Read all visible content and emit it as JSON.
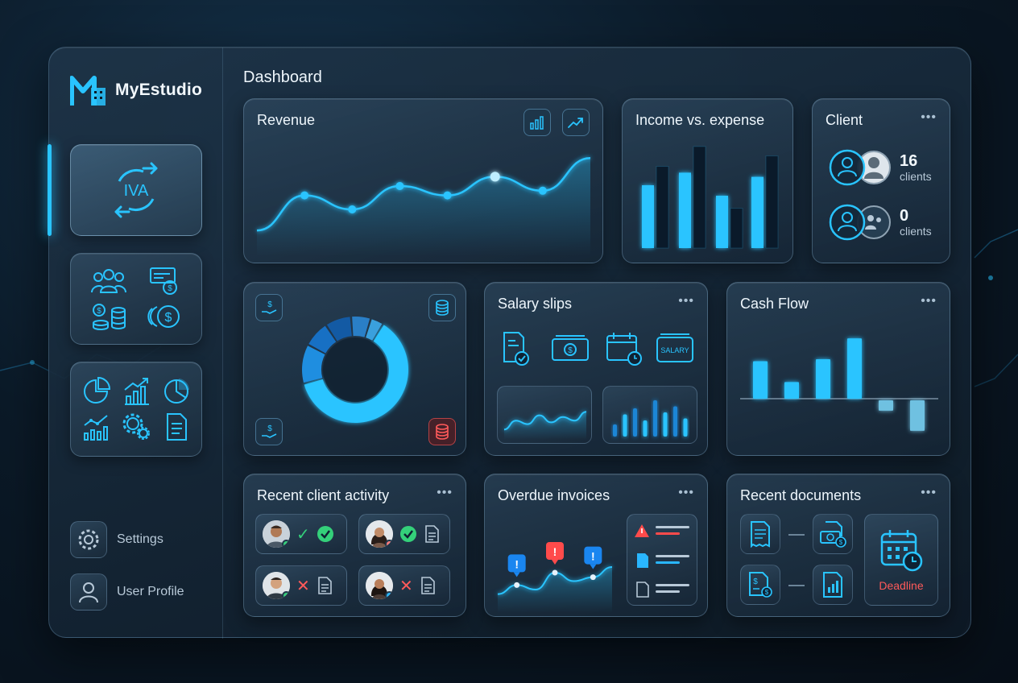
{
  "brand": {
    "name": "MyEstudio"
  },
  "page": {
    "title": "Dashboard"
  },
  "sidebar": {
    "cards": [
      {
        "icons": [
          "iva-exchange-icon"
        ],
        "label": "IVA",
        "active": true
      },
      {
        "icons": [
          "team-icon",
          "salary-slip-icon",
          "coin-transfer-icon",
          "coins-icon"
        ]
      },
      {
        "icons": [
          "pie-chart-icon",
          "bar-growth-icon",
          "pie-chart-icon",
          "line-bar-icon",
          "gears-icon",
          "document-icon"
        ]
      }
    ],
    "links": [
      {
        "label": "Settings",
        "icon": "gear-icon"
      },
      {
        "label": "User Profile",
        "icon": "user-icon"
      }
    ]
  },
  "revenue": {
    "title": "Revenue",
    "toolbar": [
      "bar-chart-icon",
      "trend-up-icon"
    ]
  },
  "income_expense": {
    "title": "Income vs. expense"
  },
  "client": {
    "title": "Client",
    "menu": "•••",
    "rows": [
      {
        "count": "16",
        "label": "clients"
      },
      {
        "count": "0",
        "label": "clients"
      }
    ]
  },
  "donut": {
    "corner_icons": [
      "hand-dollar-icon",
      "coin-stack-icon",
      "hand-dollar-icon",
      "coin-stack-alert-icon"
    ]
  },
  "salary": {
    "title": "Salary slips",
    "menu": "•••",
    "icons": [
      "checked-document-icon",
      "cash-icon",
      "calendar-clock-icon",
      "salary-card-icon"
    ],
    "salary_card_label": "SALARY"
  },
  "cashflow": {
    "title": "Cash Flow",
    "menu": "•••"
  },
  "activity": {
    "title": "Recent client activity",
    "menu": "•••",
    "items": [
      {
        "status": "approved",
        "status_dot": "#34d07a"
      },
      {
        "status": "approved",
        "status_dot": "#ff7a7a"
      },
      {
        "status": "rejected",
        "status_dot": "#34d07a"
      },
      {
        "status": "rejected",
        "status_dot": "#29b6ff"
      }
    ]
  },
  "overdue": {
    "title": "Overdue invoices",
    "menu": "•••",
    "alert_glyph": "!"
  },
  "documents": {
    "title": "Recent documents",
    "menu": "•••",
    "deadline_label": "Deadline"
  },
  "colors": {
    "accent": "#29c4ff",
    "accent_dark": "#0a1a2a",
    "alert": "#ff4b4b",
    "success": "#34d07a"
  },
  "chart_data": [
    {
      "type": "line",
      "title": "Revenue",
      "x": [
        1,
        2,
        3,
        4,
        5,
        6,
        7,
        8
      ],
      "values": [
        22,
        52,
        40,
        60,
        52,
        68,
        56,
        84
      ],
      "ylim": [
        0,
        100
      ],
      "grid": false
    },
    {
      "type": "bar",
      "title": "Income vs. expense",
      "categories": [
        "1",
        "2",
        "3",
        "4"
      ],
      "series": [
        {
          "values": [
            60,
            72,
            50,
            68
          ]
        },
        {
          "values": [
            78,
            97,
            38,
            88
          ]
        }
      ],
      "ylim": [
        0,
        100
      ]
    },
    {
      "type": "pie",
      "values": [
        62,
        12,
        8,
        8,
        6,
        4
      ]
    },
    {
      "type": "bar",
      "title": "Cash Flow",
      "categories": [
        "1",
        "2",
        "3",
        "4",
        "5",
        "6"
      ],
      "values": [
        54,
        24,
        57,
        87,
        -15,
        -44
      ],
      "ylim": [
        -50,
        100
      ]
    },
    {
      "type": "line",
      "x": [
        1,
        2,
        3,
        4,
        5,
        6,
        7,
        8
      ],
      "values": [
        20,
        45,
        35,
        60,
        40,
        55,
        45,
        70
      ],
      "ylim": [
        0,
        100
      ]
    },
    {
      "type": "bar",
      "values": [
        30,
        55,
        70,
        40,
        90,
        60,
        75,
        45
      ],
      "ylim": [
        0,
        100
      ]
    },
    {
      "type": "line",
      "title": "Overdue invoices",
      "x": [
        1,
        2,
        3,
        4,
        5,
        6,
        7
      ],
      "values": [
        22,
        38,
        30,
        60,
        45,
        52,
        70
      ],
      "ylim": [
        0,
        100
      ]
    }
  ]
}
